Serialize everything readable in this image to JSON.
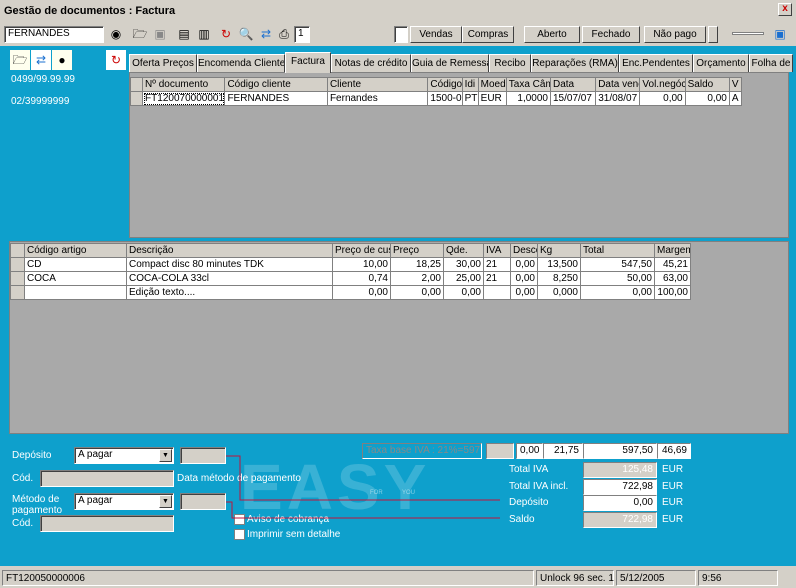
{
  "window": {
    "title": "Gestão de documentos : Factura",
    "close_glyph": "x"
  },
  "toolbar": {
    "entity_value": "FERNANDES",
    "copies_value": "1",
    "vendas_label": "Vendas",
    "compras_label": "Compras",
    "aberto_label": "Aberto",
    "fechado_label": "Fechado",
    "nao_pago_label": "Não pago"
  },
  "left_panel": {
    "phone1": "0499/99.99.99",
    "phone2": "02/39999999"
  },
  "tabs": [
    {
      "label": "Oferta Preços"
    },
    {
      "label": "Encomenda Cliente"
    },
    {
      "label": "Factura"
    },
    {
      "label": "Notas de crédito"
    },
    {
      "label": "Guia de Remessa"
    },
    {
      "label": "Recibo"
    },
    {
      "label": "Reparações (RMA)"
    },
    {
      "label": "Enc.Pendentes"
    },
    {
      "label": "Orçamento"
    },
    {
      "label": "Folha de"
    }
  ],
  "documents": {
    "headers": [
      "Nº documento",
      "Código cliente",
      "Cliente",
      "Código",
      "Idi",
      "Moed",
      "Taxa Câm",
      "Data",
      "Data venc",
      "Vol.negóc",
      "Saldo",
      "V"
    ],
    "rows": [
      [
        "FT12007000000​1",
        "FERNANDES",
        "Fernandes",
        "1500-0",
        "PT",
        "EUR",
        "1,0000",
        "15/07/07",
        "31/08/07",
        "0,00",
        "0,00",
        "A"
      ]
    ]
  },
  "lines": {
    "headers": [
      "",
      "Código artigo",
      "Descrição",
      "Preço de cus",
      "Preço",
      "Qde.",
      "IVA",
      "Desco",
      "Kg",
      "Total",
      "Margem"
    ],
    "rows": [
      [
        "",
        "CD",
        "Compact disc 80 minutes TDK",
        "10,00",
        "18,25",
        "30,00",
        "21",
        "0,00",
        "13,500",
        "547,50",
        "45,21"
      ],
      [
        "",
        "COCA",
        "COCA-COLA 33cl",
        "0,74",
        "2,00",
        "25,00",
        "21",
        "0,00",
        "8,250",
        "50,00",
        "63,00"
      ],
      [
        "",
        "",
        "Edição texto....",
        "0,00",
        "0,00",
        "0,00",
        "",
        "0,00",
        "0,000",
        "0,00",
        "100,00"
      ]
    ]
  },
  "payment": {
    "deposito_label": "Depósito",
    "deposito_value": "A pagar",
    "cod_label": "Cód.",
    "data_metodo_label": "Data método de pagamento",
    "metodo_label": "Método de pagamento",
    "metodo_value": "A pagar",
    "cod2_label": "Cód.",
    "aviso_label": "Aviso de cobrança",
    "imprimir_label": "Imprimir sem detalhe"
  },
  "totals": {
    "taxa_base": "Taxa base IVA : 21%=597,50",
    "desc_value": "0,00",
    "kg_value": "21,75",
    "total_value": "597,50",
    "margem_value": "46,69",
    "total_iva_label": "Total IVA",
    "total_iva_value": "125,48",
    "total_iva_incl_label": "Total IVA incl.",
    "total_iva_incl_value": "722,98",
    "deposito_label": "Depósito",
    "deposito_value": "0,00",
    "saldo_label": "Saldo",
    "saldo_value": "722,98",
    "currency": "EUR"
  },
  "watermark": {
    "text": "EASY",
    "sub1": "FOR",
    "sub2": "YOU"
  },
  "status": {
    "doc": "FT120050000006",
    "unlock": "Unlock 96 sec. 1",
    "date": "5/12/2005",
    "time": "9:56"
  },
  "colors": {
    "background": "#0ea0cc",
    "chrome": "#d4d0c8"
  }
}
